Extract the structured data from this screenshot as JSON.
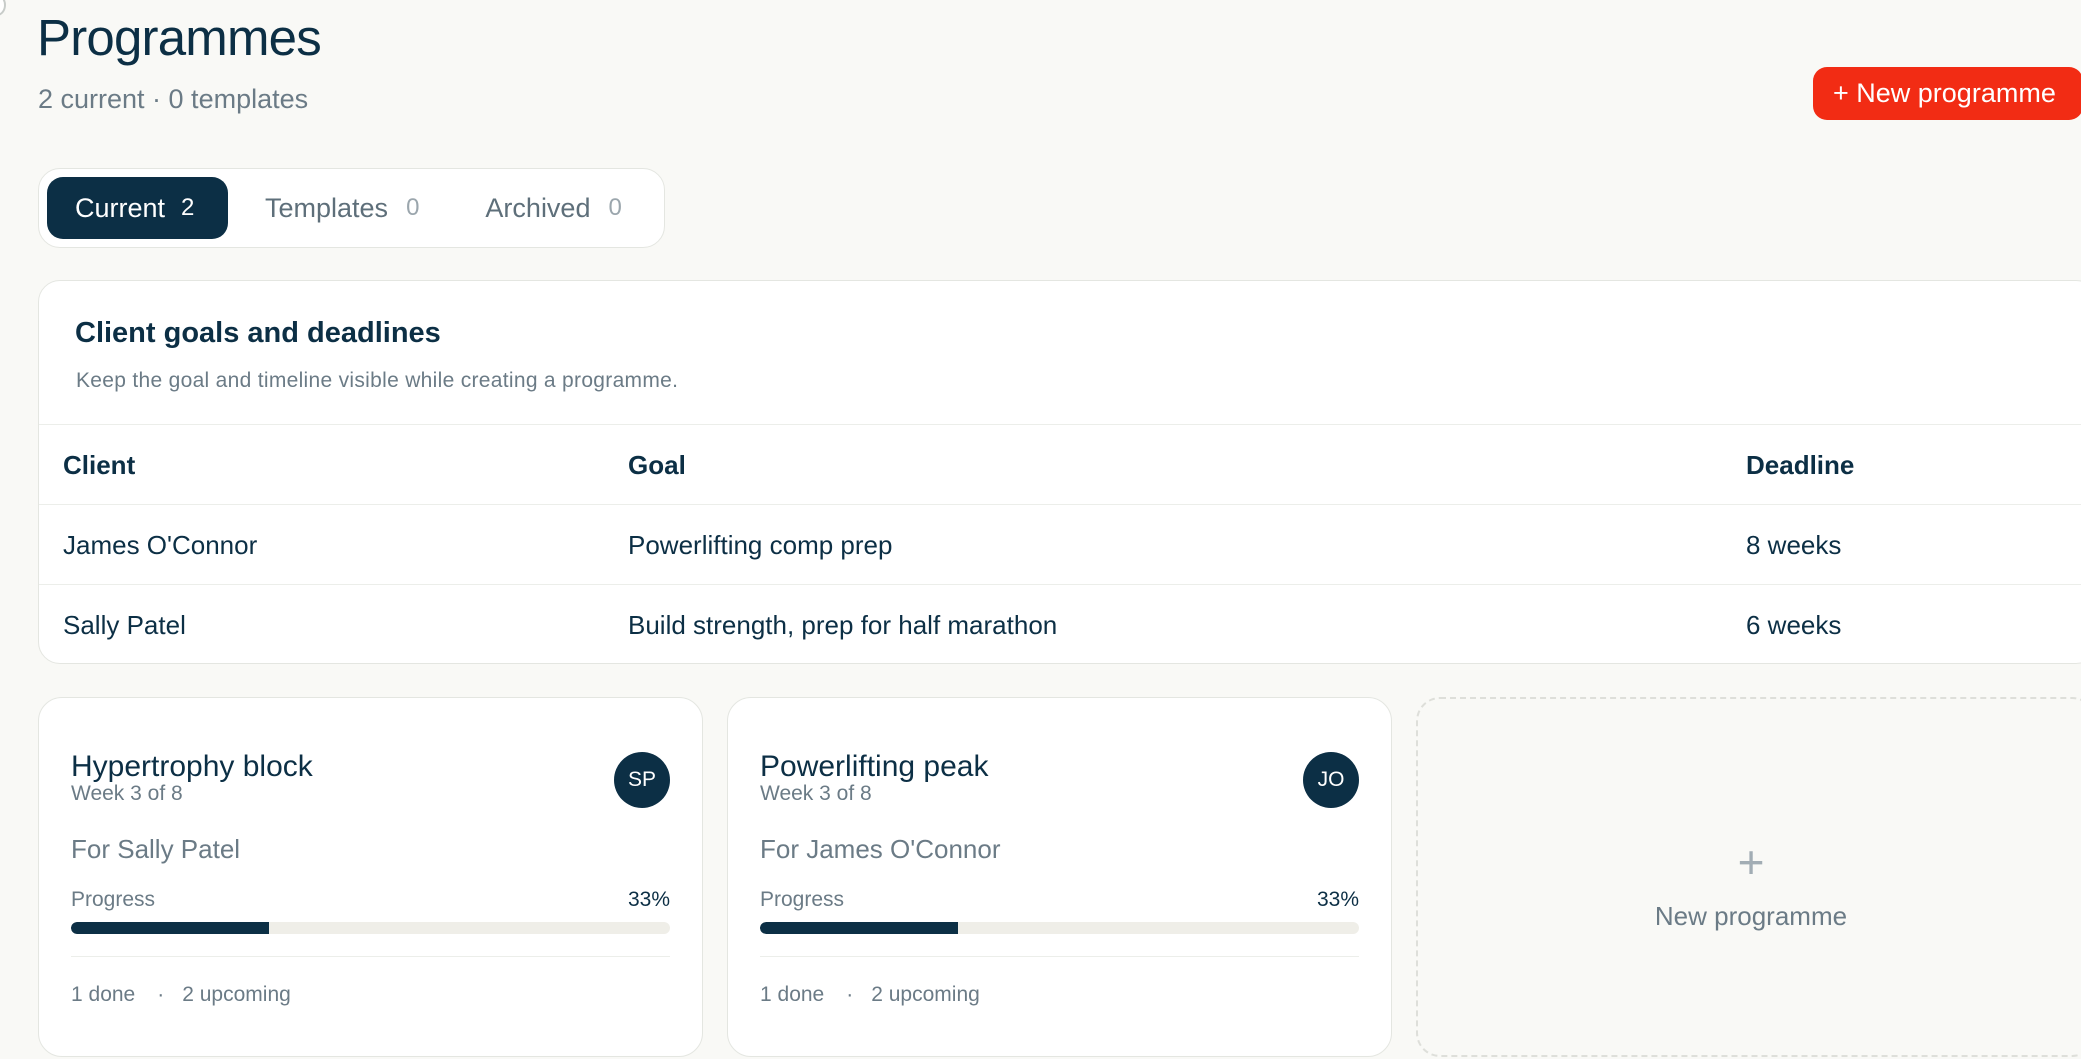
{
  "header": {
    "title": "Programmes",
    "subtitle": "2 current · 0 templates",
    "new_button_label": "+ New programme"
  },
  "tabs": [
    {
      "label": "Current",
      "count": "2",
      "active": true
    },
    {
      "label": "Templates",
      "count": "0",
      "active": false
    },
    {
      "label": "Archived",
      "count": "0",
      "active": false
    }
  ],
  "goals": {
    "title": "Client goals and deadlines",
    "subtitle": "Keep the goal and timeline visible while creating a programme.",
    "columns": [
      "Client",
      "Goal",
      "Deadline"
    ],
    "rows": [
      [
        "James O'Connor",
        "Powerlifting comp prep",
        "8 weeks"
      ],
      [
        "Sally Patel",
        "Build strength, prep for half marathon",
        "6 weeks"
      ]
    ]
  },
  "programmes": [
    {
      "title": "Hypertrophy block",
      "week": "Week 3 of 8",
      "avatar": "SP",
      "for": "For Sally Patel",
      "progress_label": "Progress",
      "progress_text": "33%",
      "progress": 0.33,
      "done": "1 done",
      "separator": "·",
      "upcoming": "2 upcoming"
    },
    {
      "title": "Powerlifting peak",
      "week": "Week 3 of 8",
      "avatar": "JO",
      "for": "For James O'Connor",
      "progress_label": "Progress",
      "progress_text": "33%",
      "progress": 0.33,
      "done": "1 done",
      "separator": "·",
      "upcoming": "2 upcoming"
    }
  ],
  "new_card": {
    "icon": "plus-icon",
    "plus": "+",
    "label": "New programme"
  },
  "colors": {
    "accent": "#f22c14",
    "primary": "#0c2f45",
    "muted": "#6b7b86",
    "background": "#f9f9f6"
  }
}
